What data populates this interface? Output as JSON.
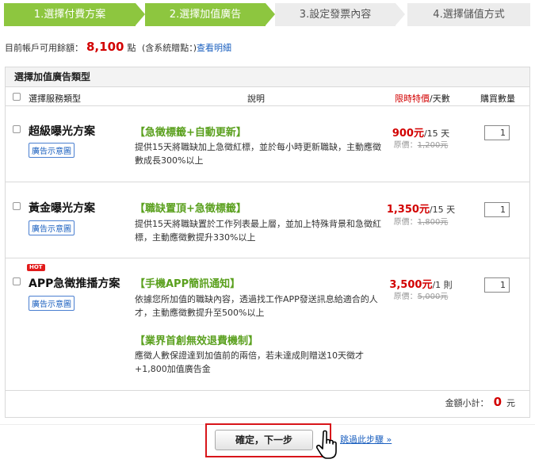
{
  "steps": [
    {
      "label": "1.選擇付費方案",
      "state": "done"
    },
    {
      "label": "2.選擇加值廣告",
      "state": "active"
    },
    {
      "label": "3.設定發票內容",
      "state": "todo"
    },
    {
      "label": "4.選擇儲值方式",
      "state": "todo"
    }
  ],
  "balance": {
    "prefix": "目前帳戶可用餘額：",
    "amount": "8,100",
    "unit": "點",
    "note": "(含系統贈點：)",
    "link": "查看明細"
  },
  "panel": {
    "title": "選擇加值廣告類型",
    "headers": {
      "type": "選擇服務類型",
      "desc": "說明",
      "price_red": "限時特價",
      "price_rest": "/天數",
      "qty": "購買數量"
    }
  },
  "plans": [
    {
      "name": "超級曝光方案",
      "demo": "廣告示意圖",
      "feature": "【急徵標籤+自動更新】",
      "desc": "提供15天將職缺加上急徵紅標，並於每小時更新職缺，主動應徵數成長300%以上",
      "price": "900元",
      "period": "/15 天",
      "orig_label": "原價：",
      "orig_price": "1,200元",
      "qty": "1"
    },
    {
      "name": "黃金曝光方案",
      "demo": "廣告示意圖",
      "feature": "【職缺置頂+急徵標籤】",
      "desc": "提供15天將職缺置於工作列表最上層，並加上特殊背景和急徵紅標，主動應徵數提升330%以上",
      "price": "1,350元",
      "period": "/15 天",
      "orig_label": "原價：",
      "orig_price": "1,800元",
      "qty": "1"
    },
    {
      "name": "APP急徵推播方案",
      "hot": "HOT",
      "demo": "廣告示意圖",
      "feature": "【手機APP簡訊通知】",
      "desc": "依據您所加值的職缺內容，透過找工作APP發送訊息給適合的人才，主動應徵數提升至500%以上",
      "feature2": "【業界首創無效退費機制】",
      "desc2": "應徵人數保證達到加值前的兩倍，若未達成則贈送10天徵才+1,800加值廣告金",
      "price": "3,500元",
      "period": "/1 則",
      "orig_label": "原價：",
      "orig_price": "5,000元",
      "qty": "1"
    }
  ],
  "subtotal": {
    "label": "金額小計：",
    "value": "0",
    "unit": "元"
  },
  "actions": {
    "next": "確定，下一步",
    "skip": "跳過此步驟 »"
  },
  "colors": {
    "step_green": "#8dc63f",
    "step_gray": "#ececec",
    "price_red": "#d20000",
    "feature_green": "#5aa01e",
    "link_blue": "#1a5fbf",
    "highlight_red": "#d8151a"
  }
}
